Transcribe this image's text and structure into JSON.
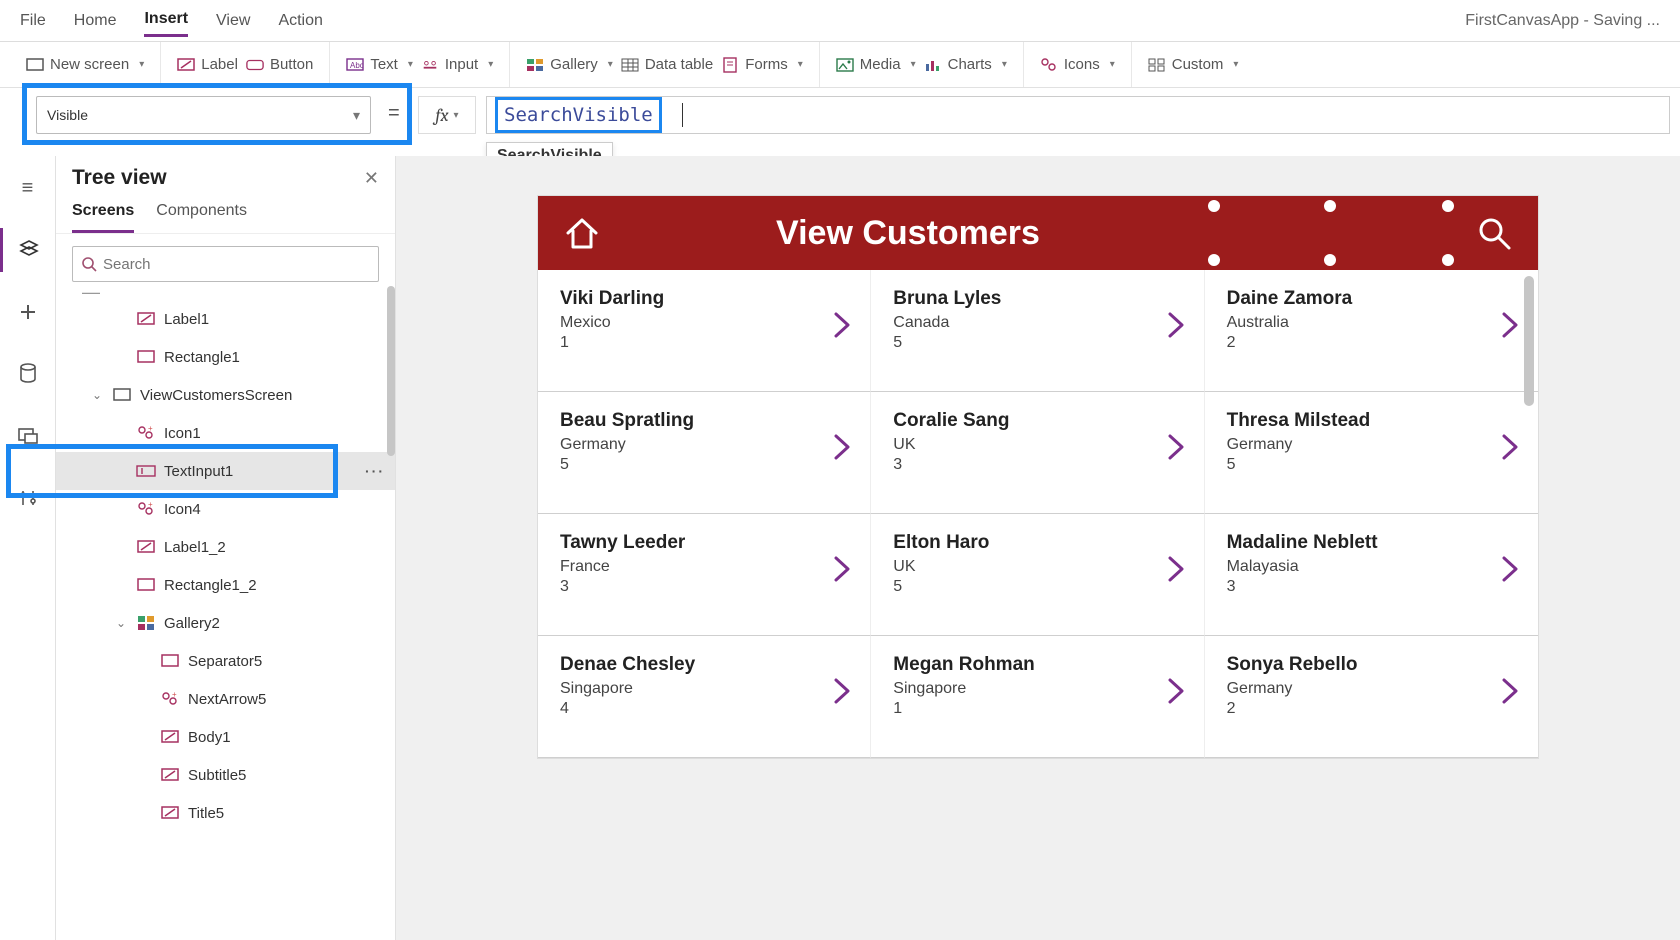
{
  "app_title": "FirstCanvasApp - Saving ...",
  "menubar": [
    "File",
    "Home",
    "Insert",
    "View",
    "Action"
  ],
  "menubar_active": 2,
  "ribbon": {
    "new_screen": "New screen",
    "label": "Label",
    "button": "Button",
    "text": "Text",
    "input": "Input",
    "gallery": "Gallery",
    "data_table": "Data table",
    "forms": "Forms",
    "media": "Media",
    "charts": "Charts",
    "icons": "Icons",
    "custom": "Custom"
  },
  "formula": {
    "property": "Visible",
    "fx": "fx",
    "value": "SearchVisible",
    "suggestion": "SearchVisible"
  },
  "tree_panel": {
    "title": "Tree view",
    "tabs": [
      "Screens",
      "Components"
    ],
    "active_tab": 0,
    "search_placeholder": "Search",
    "items": [
      {
        "depth": 2,
        "icon": "label",
        "label": "Label1"
      },
      {
        "depth": 2,
        "icon": "rect",
        "label": "Rectangle1"
      },
      {
        "depth": 1,
        "icon": "screen",
        "label": "ViewCustomersScreen",
        "expanded": true
      },
      {
        "depth": 2,
        "icon": "groupicon",
        "label": "Icon1"
      },
      {
        "depth": 2,
        "icon": "textinput",
        "label": "TextInput1",
        "selected": true,
        "more": true
      },
      {
        "depth": 2,
        "icon": "groupicon",
        "label": "Icon4"
      },
      {
        "depth": 2,
        "icon": "label",
        "label": "Label1_2"
      },
      {
        "depth": 2,
        "icon": "rect",
        "label": "Rectangle1_2"
      },
      {
        "depth": 2,
        "icon": "gallery",
        "label": "Gallery2",
        "expanded": true
      },
      {
        "depth": 3,
        "icon": "rect",
        "label": "Separator5"
      },
      {
        "depth": 3,
        "icon": "groupicon",
        "label": "NextArrow5"
      },
      {
        "depth": 3,
        "icon": "label",
        "label": "Body1"
      },
      {
        "depth": 3,
        "icon": "label",
        "label": "Subtitle5"
      },
      {
        "depth": 3,
        "icon": "label",
        "label": "Title5"
      }
    ]
  },
  "canvas": {
    "header_title": "View Customers",
    "customers": [
      {
        "name": "Viki Darling",
        "country": "Mexico",
        "num": "1"
      },
      {
        "name": "Bruna Lyles",
        "country": "Canada",
        "num": "5"
      },
      {
        "name": "Daine Zamora",
        "country": "Australia",
        "num": "2"
      },
      {
        "name": "Beau Spratling",
        "country": "Germany",
        "num": "5"
      },
      {
        "name": "Coralie Sang",
        "country": "UK",
        "num": "3"
      },
      {
        "name": "Thresa Milstead",
        "country": "Germany",
        "num": "5"
      },
      {
        "name": "Tawny Leeder",
        "country": "France",
        "num": "3"
      },
      {
        "name": "Elton Haro",
        "country": "UK",
        "num": "5"
      },
      {
        "name": "Madaline Neblett",
        "country": "Malayasia",
        "num": "3"
      },
      {
        "name": "Denae Chesley",
        "country": "Singapore",
        "num": "4"
      },
      {
        "name": "Megan Rohman",
        "country": "Singapore",
        "num": "1"
      },
      {
        "name": "Sonya Rebello",
        "country": "Germany",
        "num": "2"
      }
    ]
  }
}
